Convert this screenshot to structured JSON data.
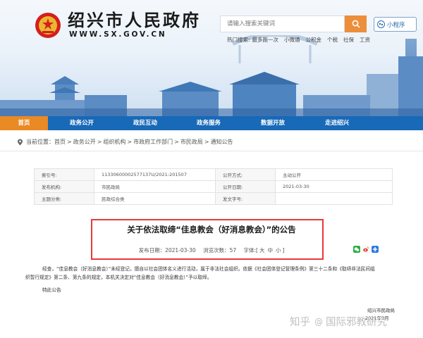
{
  "header": {
    "site_title": "绍兴市人民政府",
    "site_domain": "WWW.SX.GOV.CN",
    "emblem_icon": "national-emblem-icon",
    "search": {
      "placeholder": "请输入搜索关键词",
      "button_icon": "search-icon"
    },
    "mini_program": {
      "label": "小程序",
      "icon": "wechat-mini-program-icon"
    },
    "hot_search": {
      "label": "热门搜索:",
      "items": [
        "最多跑一次",
        "小微通",
        "公积金",
        "个税",
        "社保",
        "工资"
      ]
    }
  },
  "nav": {
    "items": [
      "首页",
      "政务公开",
      "政民互动",
      "政务服务",
      "数据开放",
      "走进绍兴"
    ],
    "active_index": 0,
    "colors": {
      "bar": "#1869b8",
      "active": "#e98a24"
    }
  },
  "breadcrumb": {
    "icon": "location-pin-icon",
    "prefix": "当前位置：",
    "items": [
      "首页",
      "政务公开",
      "组织机构",
      "市政府工作部门",
      "市民政局",
      "通知公告"
    ],
    "separator": ">"
  },
  "info_table": {
    "rows": [
      {
        "label1": "索引号:",
        "value1": "11330600002577137U/2021-201507",
        "label2": "公开方式:",
        "value2": "主动公开"
      },
      {
        "label1": "发布机构:",
        "value1": "市民政局",
        "label2": "公开日期:",
        "value2": "2021-03-30"
      },
      {
        "label1": "主题分类:",
        "value1": "民政综合类",
        "label2": "发文字号:",
        "value2": ""
      }
    ]
  },
  "article": {
    "title": "关于依法取缔“佳息教会（好消息教会）”的公告",
    "publish_date_label": "发布日期：",
    "publish_date": "2021-03-30",
    "views_label": "浏览次数：",
    "views": "57",
    "font_label": "字体:",
    "font_open": "[",
    "font_sizes": [
      "大",
      "中",
      "小"
    ],
    "font_close": "]",
    "share_icons": [
      "wechat-share-icon",
      "weibo-share-icon",
      "more-share-icon"
    ],
    "highlight_color": "#e53a3a",
    "body_line1": "经查，“佳息教会（好消息教会）”未经登记，擅自以社会团体名义进行活动，属于非法社会组织。依据《社会团体登记管理条例》第三十二条和《取缔非法民间组",
    "body_line2": "织暂行规定》第二条、第九条的规定，本机关决定对“佳息教会（好消息教会）”予以取缔。",
    "signoff": "特此公告",
    "signature_org": "绍兴市民政局",
    "signature_date": "2021年3月"
  },
  "watermark": {
    "prefix": "知乎",
    "at": "@",
    "handle": "国际邪教研究"
  }
}
